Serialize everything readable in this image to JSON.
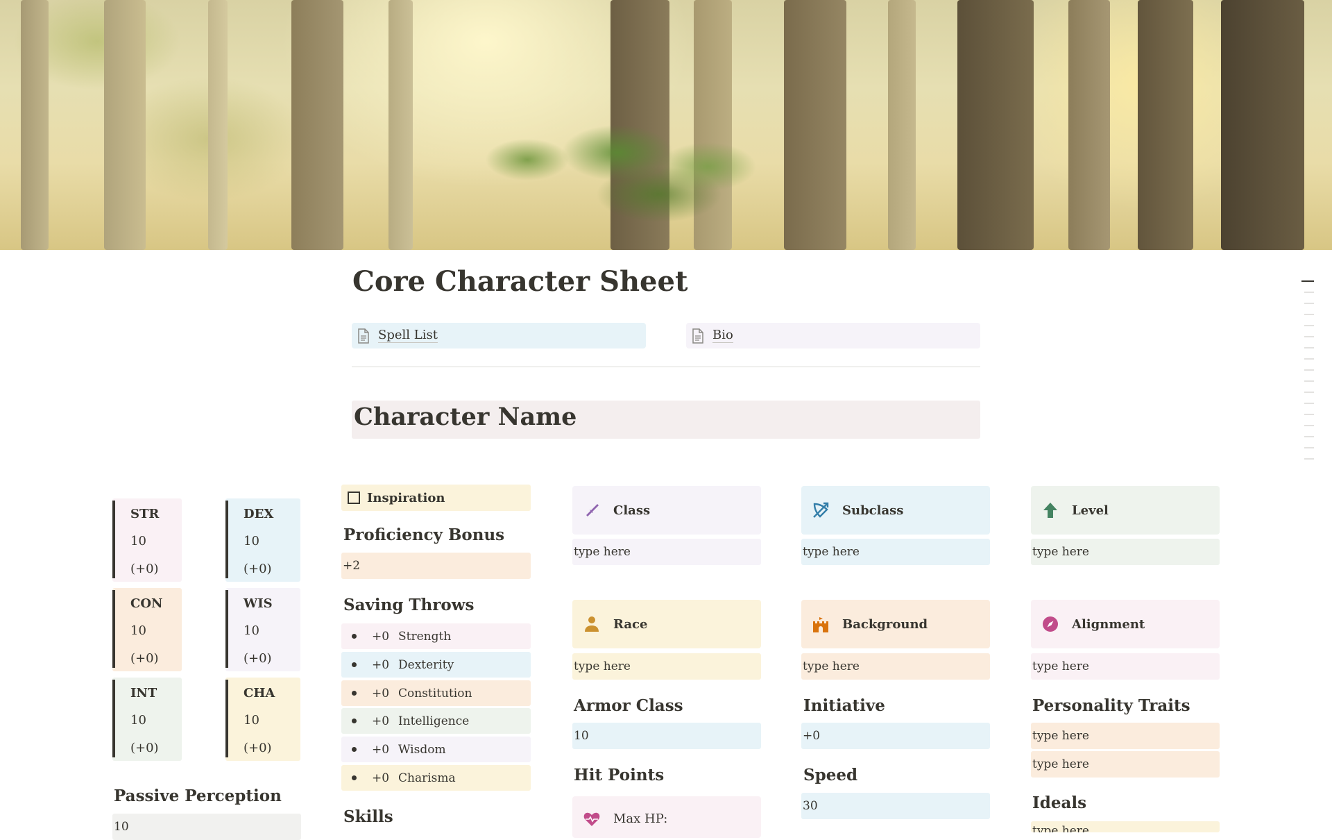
{
  "page": {
    "title": "Core Character Sheet"
  },
  "links": [
    {
      "label": "Spell List",
      "icon": "page-icon"
    },
    {
      "label": "Bio",
      "icon": "page-icon"
    }
  ],
  "character_name": "Character Name",
  "abilities": [
    {
      "abbr": "STR",
      "score": "10",
      "mod": "(+0)",
      "color": "#faf1f5"
    },
    {
      "abbr": "DEX",
      "score": "10",
      "mod": "(+0)",
      "color": "#e7f3f8"
    },
    {
      "abbr": "CON",
      "score": "10",
      "mod": "(+0)",
      "color": "#fbecdd"
    },
    {
      "abbr": "WIS",
      "score": "10",
      "mod": "(+0)",
      "color": "#f6f3f9"
    },
    {
      "abbr": "INT",
      "score": "10",
      "mod": "(+0)",
      "color": "#eef3ed"
    },
    {
      "abbr": "CHA",
      "score": "10",
      "mod": "(+0)",
      "color": "#fbf3db"
    }
  ],
  "passive_perception": {
    "label": "Passive Perception",
    "value": "10"
  },
  "inspiration": {
    "label": "Inspiration",
    "checked": false
  },
  "proficiency": {
    "label": "Proficiency Bonus",
    "value": "+2"
  },
  "saving_throws": {
    "label": "Saving Throws",
    "items": [
      {
        "mod": "+0",
        "name": "Strength"
      },
      {
        "mod": "+0",
        "name": "Dexterity"
      },
      {
        "mod": "+0",
        "name": "Constitution"
      },
      {
        "mod": "+0",
        "name": "Intelligence"
      },
      {
        "mod": "+0",
        "name": "Wisdom"
      },
      {
        "mod": "+0",
        "name": "Charisma"
      }
    ]
  },
  "skills": {
    "label": "Skills"
  },
  "info": {
    "class": {
      "label": "Class",
      "value": "type here",
      "icon": "sword-icon",
      "icon_color": "#9065b0"
    },
    "subclass": {
      "label": "Subclass",
      "value": "type here",
      "icon": "bow-arrow-icon",
      "icon_color": "#337ea9"
    },
    "level": {
      "label": "Level",
      "value": "type here",
      "icon": "arrow-up-icon",
      "icon_color": "#448361"
    },
    "race": {
      "label": "Race",
      "value": "type here",
      "icon": "person-icon",
      "icon_color": "#cb912f"
    },
    "background": {
      "label": "Background",
      "value": "type here",
      "icon": "castle-icon",
      "icon_color": "#d9730d"
    },
    "alignment": {
      "label": "Alignment",
      "value": "type here",
      "icon": "compass-icon",
      "icon_color": "#c14c8a"
    }
  },
  "armor_class": {
    "label": "Armor Class",
    "value": "10"
  },
  "initiative": {
    "label": "Initiative",
    "value": "+0"
  },
  "hit_points": {
    "label": "Hit Points",
    "max_label": "Max HP:",
    "icon": "heart-pulse-icon",
    "icon_color": "#c14c8a"
  },
  "speed": {
    "label": "Speed",
    "value": "30"
  },
  "personality": {
    "label": "Personality Traits",
    "values": [
      "type here",
      "type here"
    ]
  },
  "ideals": {
    "label": "Ideals",
    "value": "type here"
  }
}
